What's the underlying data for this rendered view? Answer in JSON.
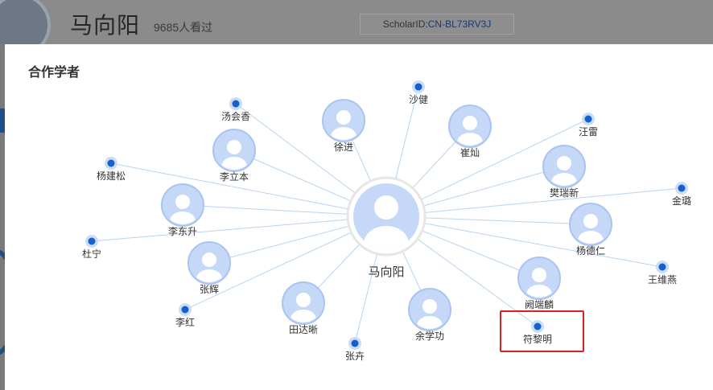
{
  "header": {
    "scholar_name": "马向阳",
    "views": "9685人看过",
    "scholar_id_label": "ScholarID:",
    "scholar_id_value": "CN-BL73RV3J"
  },
  "modal": {
    "title": "合作学者"
  },
  "graph": {
    "center": {
      "name": "马向阳"
    },
    "collaborators": [
      {
        "name": "沙健",
        "style": "dot"
      },
      {
        "name": "汤会香",
        "style": "dot"
      },
      {
        "name": "徐进",
        "style": "avatar"
      },
      {
        "name": "崔灿",
        "style": "avatar"
      },
      {
        "name": "汪雷",
        "style": "dot"
      },
      {
        "name": "李立本",
        "style": "avatar"
      },
      {
        "name": "杨建松",
        "style": "dot"
      },
      {
        "name": "樊瑞新",
        "style": "avatar"
      },
      {
        "name": "李东升",
        "style": "avatar"
      },
      {
        "name": "金璐",
        "style": "dot"
      },
      {
        "name": "杜宁",
        "style": "dot"
      },
      {
        "name": "杨德仁",
        "style": "avatar"
      },
      {
        "name": "张辉",
        "style": "avatar"
      },
      {
        "name": "王维燕",
        "style": "dot"
      },
      {
        "name": "阙端麟",
        "style": "avatar"
      },
      {
        "name": "李红",
        "style": "dot"
      },
      {
        "name": "田达晰",
        "style": "avatar"
      },
      {
        "name": "余学功",
        "style": "avatar"
      },
      {
        "name": "符黎明",
        "style": "dot",
        "highlighted": true
      },
      {
        "name": "张卉",
        "style": "dot"
      }
    ]
  },
  "colors": {
    "edge": "#b8d4f0",
    "avatar_fill": "#c5d8f7",
    "avatar_ring": "#a9c4f2",
    "dot": "#1560cc",
    "highlight": "#e02020"
  }
}
